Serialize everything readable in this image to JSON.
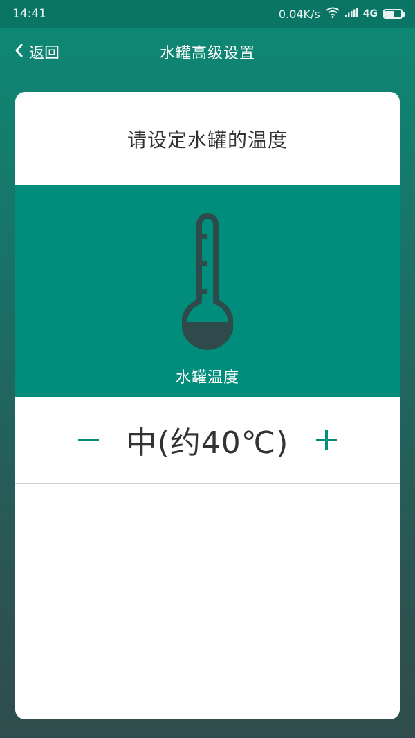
{
  "status_bar": {
    "time": "14:41",
    "speed": "0.04K/s",
    "network": "4G",
    "battery_level": 0.6
  },
  "nav": {
    "back_label": "返回",
    "title": "水罐高级设置"
  },
  "card": {
    "prompt": "请设定水罐的温度",
    "hero_label": "水罐温度",
    "temperature_value": "中(约40℃)"
  },
  "colors": {
    "accent": "#008d7b",
    "text_dark": "#333333",
    "icon_dark": "#2e4a4a"
  },
  "icons": {
    "back": "chevron-left-icon",
    "thermometer": "thermometer-icon",
    "minus": "minus-icon",
    "plus": "plus-icon",
    "wifi": "wifi-icon",
    "signal": "signal-icon",
    "battery": "battery-icon"
  }
}
